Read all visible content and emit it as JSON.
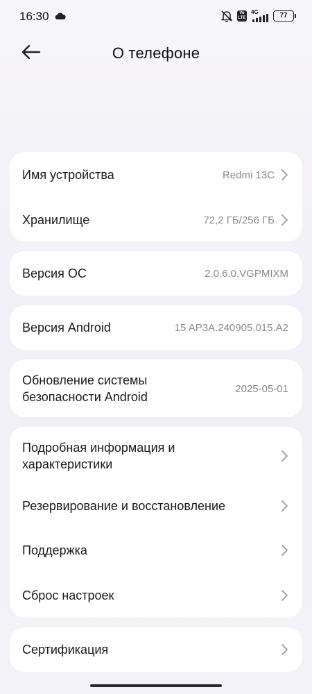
{
  "status_bar": {
    "time": "16:30",
    "network_type": "4G",
    "battery_level": "77"
  },
  "header": {
    "title": "О телефоне"
  },
  "device_name": {
    "label": "Имя устройства",
    "value": "Redmi 13C"
  },
  "storage": {
    "label": "Хранилище",
    "value": "72,2 ГБ/256 ГБ"
  },
  "os_version": {
    "label": "Версия ОС",
    "value": "2.0.6.0.VGPMIXM"
  },
  "android_version": {
    "label": "Версия Android",
    "value": "15 AP3A.240905.015.A2"
  },
  "security_update": {
    "label_line1": "Обновление системы",
    "label_line2": "безопасности Android",
    "value": "2025-05-01"
  },
  "menu": {
    "detailed_line1": "Подробная информация и",
    "detailed_line2": "характеристики",
    "backup": "Резервирование и восстановление",
    "support": "Поддержка",
    "reset": "Сброс настроек"
  },
  "certification": {
    "label": "Сертификация"
  }
}
